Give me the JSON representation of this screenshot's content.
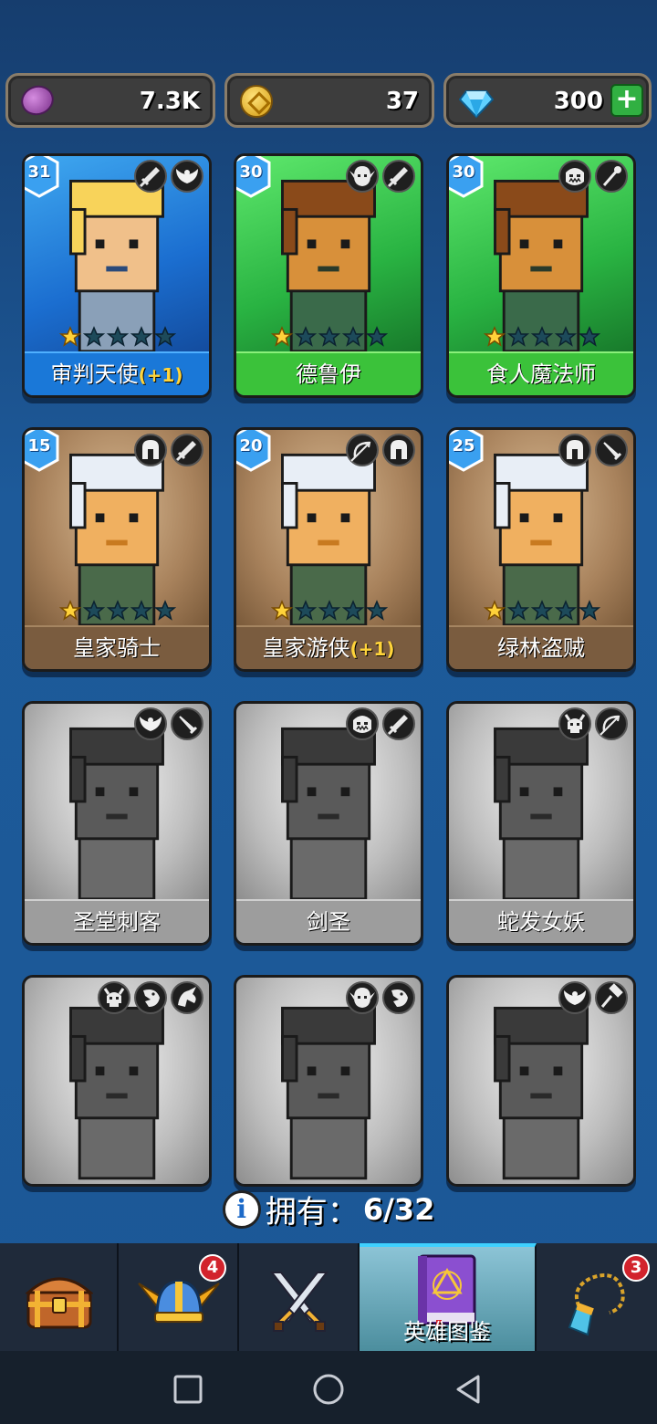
{
  "currencies": {
    "gems": {
      "value": "7.3K",
      "icon": "purple-gem-icon"
    },
    "coins": {
      "value": "37",
      "icon": "gold-coin-icon"
    },
    "diamonds": {
      "value": "300",
      "icon": "blue-diamond-icon",
      "add_label": "+"
    }
  },
  "heroes": [
    {
      "name": "审判天使",
      "bonus": "(+1)",
      "level": "31",
      "rarity": "blue",
      "stars": 1,
      "max_stars": 5,
      "classes": [
        "sword-icon",
        "angel-wings-icon"
      ],
      "locked": false
    },
    {
      "name": "德鲁伊",
      "bonus": "",
      "level": "30",
      "rarity": "green",
      "stars": 1,
      "max_stars": 5,
      "classes": [
        "elf-face-icon",
        "sword-icon"
      ],
      "locked": false
    },
    {
      "name": "食人魔法师",
      "bonus": "",
      "level": "30",
      "rarity": "green",
      "stars": 1,
      "max_stars": 5,
      "classes": [
        "ogre-face-icon",
        "staff-icon"
      ],
      "locked": false
    },
    {
      "name": "皇家骑士",
      "bonus": "",
      "level": "15",
      "rarity": "brown",
      "stars": 1,
      "max_stars": 5,
      "classes": [
        "helmet-icon",
        "sword-icon"
      ],
      "locked": false
    },
    {
      "name": "皇家游侠",
      "bonus": "(+1)",
      "level": "20",
      "rarity": "brown",
      "stars": 1,
      "max_stars": 5,
      "classes": [
        "bow-icon",
        "helmet-icon"
      ],
      "locked": false
    },
    {
      "name": "绿林盗贼",
      "bonus": "",
      "level": "25",
      "rarity": "brown",
      "stars": 1,
      "max_stars": 5,
      "classes": [
        "helmet-icon",
        "dagger-icon"
      ],
      "locked": false
    },
    {
      "name": "圣堂刺客",
      "bonus": "",
      "level": "",
      "rarity": "locked",
      "stars": 0,
      "max_stars": 0,
      "classes": [
        "angel-wings-icon",
        "dagger-icon"
      ],
      "locked": true
    },
    {
      "name": "剑圣",
      "bonus": "",
      "level": "",
      "rarity": "locked",
      "stars": 0,
      "max_stars": 0,
      "classes": [
        "ogre-face-icon",
        "sword-icon"
      ],
      "locked": true
    },
    {
      "name": "蛇发女妖",
      "bonus": "",
      "level": "",
      "rarity": "locked",
      "stars": 0,
      "max_stars": 0,
      "classes": [
        "demon-skull-icon",
        "bow-icon"
      ],
      "locked": true
    },
    {
      "name": "",
      "bonus": "",
      "level": "",
      "rarity": "locked",
      "stars": 0,
      "max_stars": 0,
      "classes": [
        "demon-skull-icon",
        "beast-icon",
        "dragon-icon"
      ],
      "locked": true
    },
    {
      "name": "",
      "bonus": "",
      "level": "",
      "rarity": "locked",
      "stars": 0,
      "max_stars": 0,
      "classes": [
        "elf-face-icon",
        "beast-icon"
      ],
      "locked": true
    },
    {
      "name": "",
      "bonus": "",
      "level": "",
      "rarity": "locked",
      "stars": 0,
      "max_stars": 0,
      "classes": [
        "angel-wings-icon",
        "hammer-icon"
      ],
      "locked": true
    }
  ],
  "owned": {
    "label": "拥有：",
    "count": "6/32"
  },
  "bottom_nav": {
    "tabs": [
      {
        "name": "chest",
        "icon": "treasure-chest-icon",
        "badge": ""
      },
      {
        "name": "heroes",
        "icon": "winged-helmet-icon",
        "badge": "4"
      },
      {
        "name": "battle",
        "icon": "crossed-swords-icon",
        "badge": ""
      },
      {
        "name": "codex",
        "icon": "spell-book-icon",
        "badge": "",
        "label": "英雄图鉴",
        "active": true
      },
      {
        "name": "artifact",
        "icon": "amulet-icon",
        "badge": "3"
      }
    ]
  },
  "system_nav": [
    "square-recents-icon",
    "circle-home-icon",
    "triangle-back-icon"
  ]
}
